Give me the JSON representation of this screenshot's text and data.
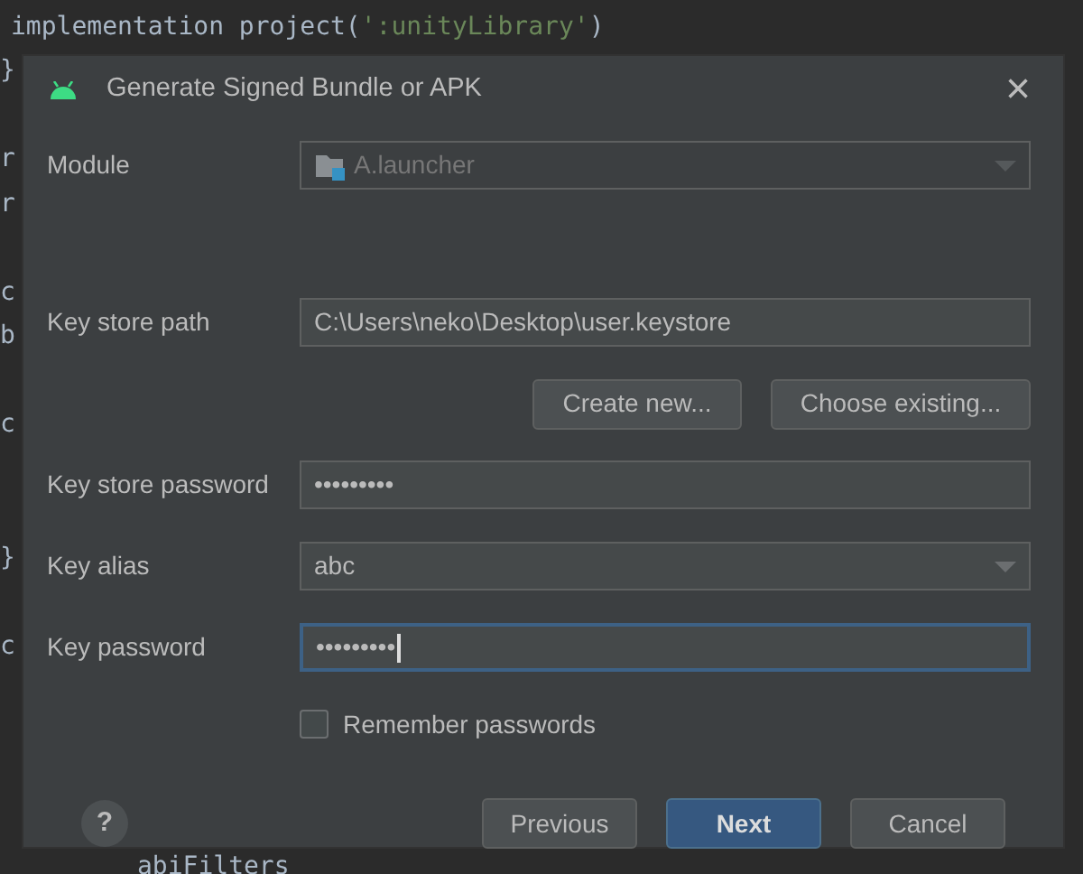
{
  "editor": {
    "first_line": [
      {
        "text": "implementation project(",
        "kind": "code"
      },
      {
        "text": "':unityLibrary'",
        "kind": "string"
      },
      {
        "text": ")",
        "kind": "code"
      }
    ],
    "edge_fragments": [
      "}",
      "r",
      "r",
      "c",
      "b",
      "c",
      "}",
      "c"
    ],
    "last_line": "abiFilters"
  },
  "dialog": {
    "title": "Generate Signed Bundle or APK",
    "close": "×",
    "fields": [
      {
        "kind": "combo",
        "label": "Module",
        "value": "A.launcher",
        "disabled": true,
        "focused": false,
        "icon": true
      },
      {
        "kind": "spacer"
      },
      {
        "kind": "text",
        "label": "Key store path",
        "value": "C:\\Users\\neko\\Desktop\\user.keystore",
        "disabled": false,
        "focused": false
      },
      {
        "kind": "buttons",
        "buttons": [
          "Create new...",
          "Choose existing..."
        ]
      },
      {
        "kind": "password",
        "label": "Key store password",
        "value": "•••••••••",
        "disabled": false,
        "focused": false
      },
      {
        "kind": "combo",
        "label": "Key alias",
        "value": "abc",
        "disabled": false,
        "focused": false,
        "icon": false
      },
      {
        "kind": "password",
        "label": "Key password",
        "value": "•••••••••",
        "disabled": false,
        "focused": true
      }
    ],
    "remember": {
      "label": "Remember passwords",
      "checked": false
    },
    "help": "?",
    "footer_buttons": [
      {
        "label": "Previous",
        "primary": false
      },
      {
        "label": "Next",
        "primary": true
      },
      {
        "label": "Cancel",
        "primary": false
      }
    ]
  }
}
